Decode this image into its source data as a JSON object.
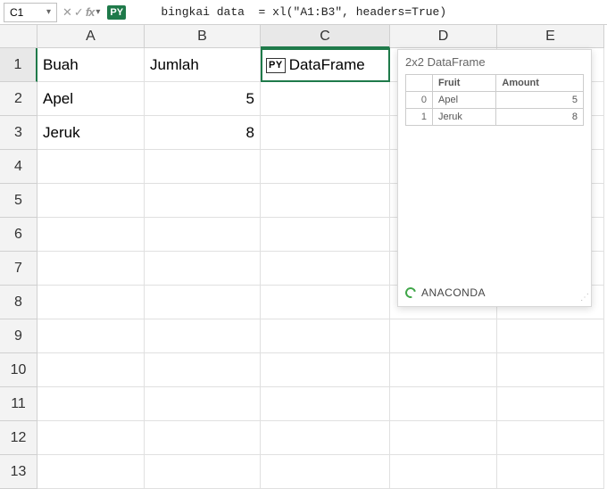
{
  "formula_bar": {
    "cell_ref": "C1",
    "py_badge": "PY",
    "formula_text": "bingkai data  = xl(\"A1:B3\", headers=True)"
  },
  "columns": [
    "A",
    "B",
    "C",
    "D",
    "E"
  ],
  "rows_count": 13,
  "cells": {
    "A1": "Buah",
    "B1": "Jumlah",
    "A2": "Apel",
    "B2": "5",
    "A3": "Jeruk",
    "B3": "8"
  },
  "selected_cell": {
    "icon": "PY",
    "label": "DataFrame"
  },
  "preview": {
    "title": "2x2 DataFrame",
    "headers": {
      "index": "",
      "col1": "Fruit",
      "col2": "Amount"
    },
    "rows": [
      {
        "idx": "0",
        "c1": "Apel",
        "c2": "5"
      },
      {
        "idx": "1",
        "c1": "Jeruk",
        "c2": "8"
      }
    ],
    "footer_brand": "ANACONDA"
  },
  "chart_data": {
    "type": "table",
    "title": "2x2 DataFrame",
    "columns": [
      "Fruit",
      "Amount"
    ],
    "index": [
      0,
      1
    ],
    "data": [
      [
        "Apel",
        5
      ],
      [
        "Jeruk",
        8
      ]
    ]
  }
}
